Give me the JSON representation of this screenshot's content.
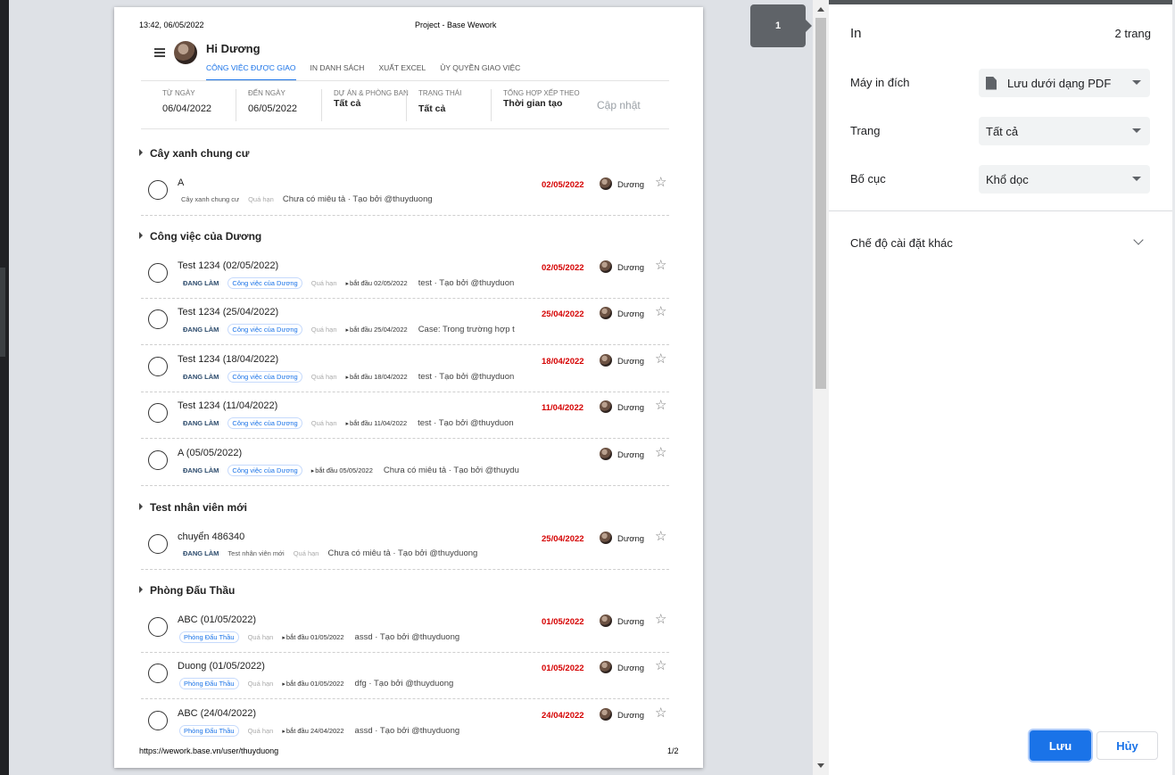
{
  "print_preview": {
    "header_time": "13:42, 06/05/2022",
    "header_title": "Project - Base Wework",
    "footer_url": "https://wework.base.vn/user/thuyduong",
    "footer_page": "1/2",
    "page_badge": "1",
    "app": {
      "greeting": "Hi Dương",
      "tabs": [
        "CÔNG VIỆC ĐƯỢC GIAO",
        "IN DANH SÁCH",
        "XUẤT EXCEL",
        "ỦY QUYỀN GIAO VIỆC"
      ],
      "filters": {
        "from_label": "TỪ NGÀY",
        "from_value": "06/04/2022",
        "to_label": "ĐẾN NGÀY",
        "to_value": "06/05/2022",
        "project_label": "DỰ ÁN & PHÒNG BAN",
        "project_value": "Tất cả",
        "status_label": "TRẠNG THÁI",
        "status_value": "Tất cả",
        "sort_label": "TỔNG HỢP XẾP THEO",
        "sort_value": "Thời gian tạo",
        "update_button": "Cập nhật"
      },
      "groups": [
        "Cây xanh chung cư",
        "Công việc của Dương",
        "Test nhân viên mới",
        "Phòng Đấu Thầu"
      ],
      "tasks": [
        {
          "title": "A",
          "status": "",
          "project": "Cây xanh chung cư",
          "overdue": "Quá hạn",
          "start": "",
          "desc": "Chưa có miêu tả · Tạo bởi @thuyduong",
          "due": "02/05/2022",
          "assignee": "Dương"
        },
        {
          "title": "Test 1234 (02/05/2022)",
          "status": "ĐANG LÀM",
          "project": "Công việc của Dương",
          "overdue": "Quá hạn",
          "start": "bắt đầu 02/05/2022",
          "desc": "test · Tạo bởi @thuyduon",
          "due": "02/05/2022",
          "assignee": "Dương"
        },
        {
          "title": "Test 1234 (25/04/2022)",
          "status": "ĐANG LÀM",
          "project": "Công việc của Dương",
          "overdue": "Quá hạn",
          "start": "bắt đầu 25/04/2022",
          "desc": "Case:  Trong trường hợp t",
          "due": "25/04/2022",
          "assignee": "Dương"
        },
        {
          "title": "Test 1234 (18/04/2022)",
          "status": "ĐANG LÀM",
          "project": "Công việc của Dương",
          "overdue": "Quá hạn",
          "start": "bắt đầu 18/04/2022",
          "desc": "test · Tạo bởi @thuyduon",
          "due": "18/04/2022",
          "assignee": "Dương"
        },
        {
          "title": "Test 1234 (11/04/2022)",
          "status": "ĐANG LÀM",
          "project": "Công việc của Dương",
          "overdue": "Quá hạn",
          "start": "bắt đầu 11/04/2022",
          "desc": "test · Tạo bởi @thuyduon",
          "due": "11/04/2022",
          "assignee": "Dương"
        },
        {
          "title": "A (05/05/2022)",
          "status": "ĐANG LÀM",
          "project": "Công việc của Dương",
          "overdue": "",
          "start": "bắt đầu 05/05/2022",
          "desc": "Chưa có miêu tả · Tạo bởi @thuydu",
          "due": "",
          "assignee": "Dương"
        },
        {
          "title": "chuyển 486340",
          "status": "ĐANG LÀM",
          "project": "Test nhân viên mới",
          "overdue": "Quá hạn",
          "start": "",
          "desc": "Chưa có miêu tả · Tạo bởi @thuyduong",
          "due": "25/04/2022",
          "assignee": "Dương"
        },
        {
          "title": "ABC (01/05/2022)",
          "status": "",
          "project": "Phòng Đấu Thầu",
          "overdue": "Quá hạn",
          "start": "bắt đầu 01/05/2022",
          "desc": "assd · Tạo bởi @thuyduong",
          "due": "01/05/2022",
          "assignee": "Dương"
        },
        {
          "title": "Duong (01/05/2022)",
          "status": "",
          "project": "Phòng Đấu Thầu",
          "overdue": "Quá hạn",
          "start": "bắt đầu 01/05/2022",
          "desc": "dfg · Tạo bởi @thuyduong",
          "due": "01/05/2022",
          "assignee": "Dương"
        },
        {
          "title": "ABC (24/04/2022)",
          "status": "",
          "project": "Phòng Đấu Thầu",
          "overdue": "Quá hạn",
          "start": "bắt đầu 24/04/2022",
          "desc": "assd · Tạo bởi @thuyduong",
          "due": "24/04/2022",
          "assignee": "Dương"
        }
      ]
    }
  },
  "settings": {
    "title": "In",
    "page_count": "2 trang",
    "destination_label": "Máy in đích",
    "destination_value": "Lưu dưới dạng PDF",
    "pages_label": "Trang",
    "pages_value": "Tất cả",
    "layout_label": "Bố cục",
    "layout_value": "Khổ dọc",
    "more_settings": "Chế độ cài đặt khác",
    "save_button": "Lưu",
    "cancel_button": "Hủy"
  },
  "colors": {
    "accent": "#1a73e8",
    "overdue_date": "#d50000"
  }
}
